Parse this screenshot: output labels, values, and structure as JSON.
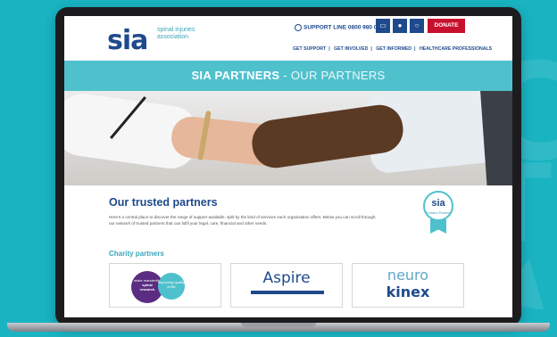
{
  "header": {
    "logo_mark": "sia",
    "logo_text": "spinal injuries association",
    "support_label": "SUPPORT LINE",
    "support_number": "0800 980 0501",
    "donate_label": "DONATE",
    "nav": [
      "GET SUPPORT",
      "GET INVOLVED",
      "GET INFORMED",
      "HEALTHCARE PROFESSIONALS"
    ]
  },
  "banner": {
    "title_bold": "SIA PARTNERS",
    "title_sep": " - ",
    "title_thin": "OUR PARTNERS"
  },
  "content": {
    "section_title": "Our trusted partners",
    "intro": "Here's a central place to discover the range of support available, split by the kind of services each organisation offers. Below you can scroll through our network of trusted partners that can fulfil your legal, care, financial and other needs.",
    "badge_mark": "sia",
    "badge_text": "Trusted Partner",
    "charity_title": "Charity partners",
    "cards": [
      {
        "line1": "stoke mandeville",
        "line2": "spinal",
        "line3": "research",
        "line4": "improving quality of life"
      },
      {
        "name": "Aspire"
      },
      {
        "name1": "neuro",
        "name2": "kinex"
      }
    ]
  },
  "icons": [
    "phone-icon",
    "cart-icon",
    "user-icon",
    "search-icon"
  ],
  "colors": {
    "brand_blue": "#1e4a8c",
    "teal": "#4fc1cd",
    "donate_red": "#c8102e",
    "background": "#19b3c2"
  }
}
